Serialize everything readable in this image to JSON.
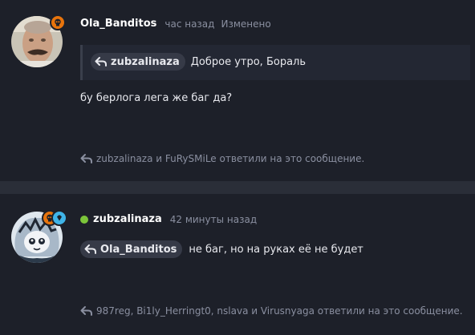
{
  "messages": [
    {
      "username": "Ola_Banditos",
      "timestamp": "час назад",
      "edited": "Изменено",
      "quote": {
        "user": "zubzalinaza",
        "text": "Доброе утро, Бораль"
      },
      "body": "бу берлога лега же баг да?",
      "replies": "zubzalinaza и FuRySMiLe ответили на это сообщение."
    },
    {
      "username": "zubzalinaza",
      "timestamp": "42 минуты назад",
      "reply_to": "Ola_Banditos",
      "body": "не баг, но на руках её не будет",
      "replies": "987reg, Bi1ly_Herringt0, nslava и Virusnyaga ответили на это сообщение."
    }
  ],
  "colors": {
    "background": "#1d2029",
    "separator": "#2a2e38",
    "muted_text": "#8a8fa0",
    "online": "#7cc53a",
    "orange_badge": "#e8740c",
    "blue_badge": "#3fb4e8"
  },
  "icons": {
    "reply": "reply-arrow-icon",
    "skull_badge": "skull-badge-icon",
    "diamond_badge": "diamond-badge-icon"
  }
}
